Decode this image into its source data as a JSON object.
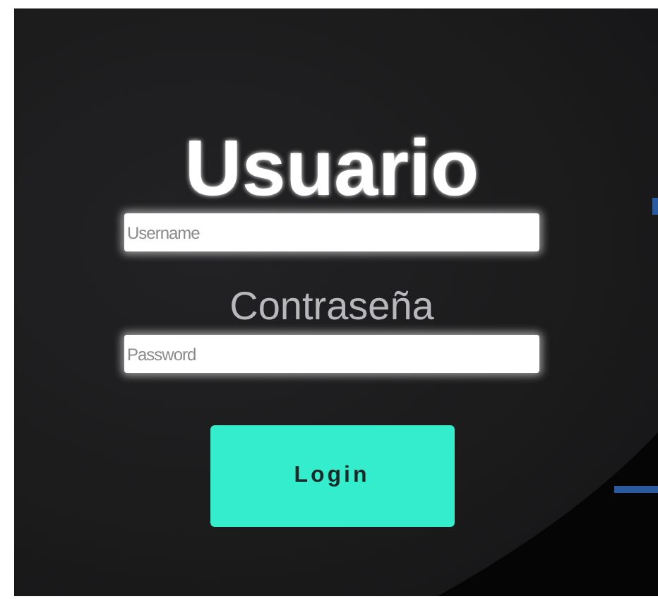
{
  "title": "Usuario",
  "fields": [
    {
      "placeholder": "Username"
    },
    {
      "label": "Contraseña",
      "placeholder": "Password"
    }
  ],
  "button": "Login"
}
